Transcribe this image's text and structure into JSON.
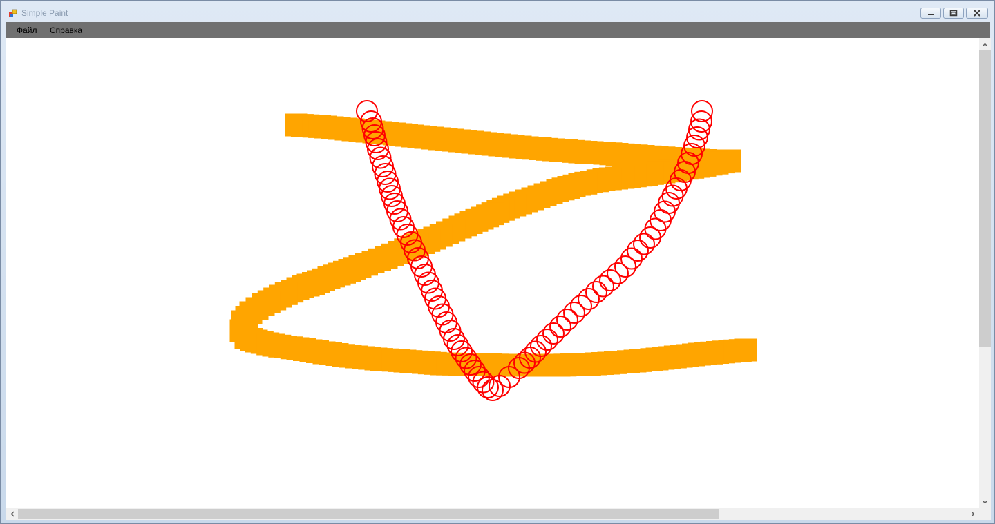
{
  "window": {
    "title": "Simple Paint",
    "menu": [
      "Файл",
      "Справка"
    ]
  },
  "canvas": {
    "background": "#ffffff",
    "shapes": [
      {
        "name": "orange-square-stroke",
        "color": "#ffa500",
        "shape": "square"
      },
      {
        "name": "red-circle-stroke",
        "color": "#ff0000",
        "shape": "circle-outline"
      }
    ]
  }
}
